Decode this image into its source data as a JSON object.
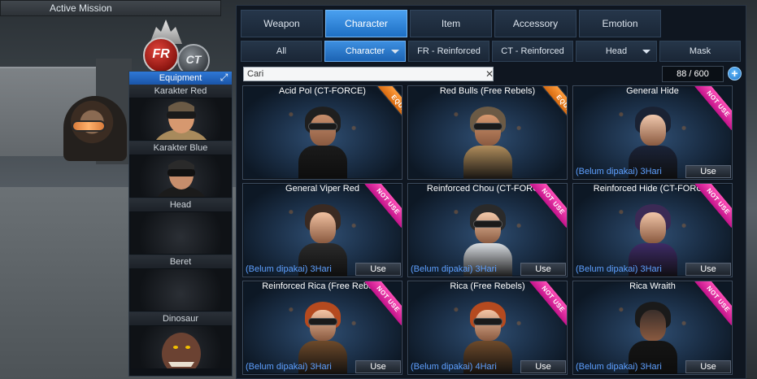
{
  "top_bar": {
    "active_mission": "Active Mission"
  },
  "logo": {
    "fr": "FR",
    "ct": "CT"
  },
  "equipment": {
    "title": "Equipment",
    "slots": [
      {
        "label": "Karakter Red"
      },
      {
        "label": "Karakter Blue"
      },
      {
        "label": "Head"
      },
      {
        "label": "Beret"
      },
      {
        "label": "Dinosaur"
      }
    ]
  },
  "tabs": [
    "Weapon",
    "Character",
    "Item",
    "Accessory",
    "Emotion"
  ],
  "active_tab": "Character",
  "subtabs": [
    "All",
    "Character",
    "FR - Reinforced",
    "CT - Reinforced",
    "Head",
    "Mask"
  ],
  "active_subtab": "Character",
  "search": {
    "placeholder": "Cari",
    "clear_icon": "close-icon"
  },
  "inventory_count": "88 / 600",
  "add_icon": "plus-icon",
  "cards": [
    {
      "name": "Acid Pol (CT-FORCE)",
      "badge": "EQUIP",
      "status": "",
      "button": "",
      "hair": "#1f1f1f",
      "skin": "#c78e6c",
      "body": "#1b1b1b",
      "goggle": true
    },
    {
      "name": "Red Bulls (Free Rebels)",
      "badge": "EQUIP",
      "status": "",
      "button": "",
      "hair": "#6b5a45",
      "skin": "#d6986f",
      "body": "#b08d5c",
      "goggle": true
    },
    {
      "name": "General Hide",
      "badge": "NOT USE",
      "status": "(Belum dipakai) 3Hari",
      "button": "Use",
      "hair": "#1a2233",
      "skin": "#f0c8ad",
      "body": "#1b2338",
      "goggle": false
    },
    {
      "name": "General Viper Red",
      "badge": "NOT USE",
      "status": "(Belum dipakai) 3Hari",
      "button": "Use",
      "hair": "#3a2a22",
      "skin": "#f0c0a0",
      "body": "#2b2b2b",
      "goggle": false
    },
    {
      "name": "Reinforced Chou (CT-FORCE)",
      "badge": "NOT USE",
      "status": "(Belum dipakai) 3Hari",
      "button": "Use",
      "hair": "#2a2a2a",
      "skin": "#f3c9aa",
      "body": "#d9dde2",
      "goggle": true
    },
    {
      "name": "Reinforced Hide (CT-FORCE)",
      "badge": "NOT USE",
      "status": "(Belum dipakai) 3Hari",
      "button": "Use",
      "hair": "#3b2a55",
      "skin": "#f1c5a8",
      "body": "#3e2b66",
      "goggle": false
    },
    {
      "name": "Reinforced Rica (Free Rebels)",
      "badge": "NOT USE",
      "status": "(Belum dipakai) 3Hari",
      "button": "Use",
      "hair": "#b54a1f",
      "skin": "#f3c4a4",
      "body": "#6d4a2b",
      "goggle": true
    },
    {
      "name": "Rica (Free Rebels)",
      "badge": "NOT USE",
      "status": "(Belum dipakai) 4Hari",
      "button": "Use",
      "hair": "#b54a1f",
      "skin": "#f3c4a4",
      "body": "#6d4a2b",
      "goggle": true
    },
    {
      "name": "Rica Wraith",
      "badge": "NOT USE",
      "status": "(Belum dipakai) 3Hari",
      "button": "Use",
      "hair": "#1a1a1a",
      "skin": "#3a2e2a",
      "body": "#151515",
      "goggle": false
    }
  ],
  "colors": {
    "accent": "#2f7fd6",
    "status_text": "#5ea0ff",
    "equip_ribbon": "#e87f22",
    "notuse_ribbon": "#e0309f"
  }
}
